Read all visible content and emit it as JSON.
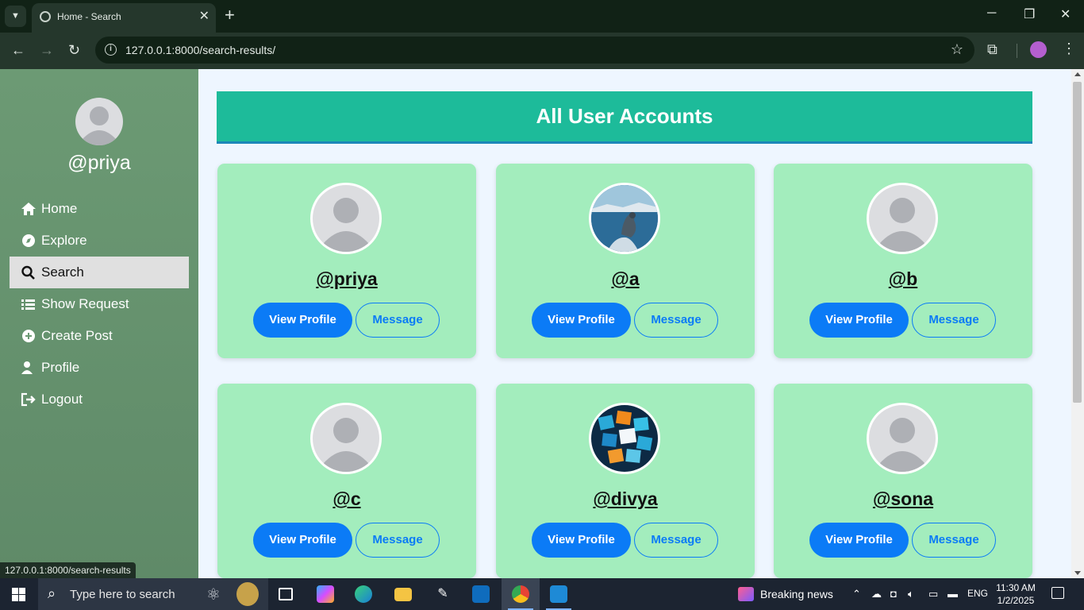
{
  "browser": {
    "tab_title": "Home - Search",
    "tab_close": "✕",
    "new_tab": "+",
    "url": "127.0.0.1:8000/search-results/",
    "status_url": "127.0.0.1:8000/search-results",
    "win_min": "─",
    "win_max": "❐",
    "win_close": "✕"
  },
  "sidebar": {
    "username": "@priya",
    "items": [
      {
        "label": "Home",
        "icon": "home-icon",
        "active": false
      },
      {
        "label": "Explore",
        "icon": "compass-icon",
        "active": false
      },
      {
        "label": "Search",
        "icon": "search-icon",
        "active": true
      },
      {
        "label": "Show Request",
        "icon": "list-icon",
        "active": false
      },
      {
        "label": "Create Post",
        "icon": "plus-circle-icon",
        "active": false
      },
      {
        "label": "Profile",
        "icon": "user-icon",
        "active": false
      },
      {
        "label": "Logout",
        "icon": "logout-icon",
        "active": false
      }
    ]
  },
  "main": {
    "heading": "All User Accounts",
    "view_label": "View Profile",
    "message_label": "Message",
    "users": [
      {
        "username": "@priya",
        "avatar": "default"
      },
      {
        "username": "@a",
        "avatar": "bird-photo"
      },
      {
        "username": "@b",
        "avatar": "default"
      },
      {
        "username": "@c",
        "avatar": "default"
      },
      {
        "username": "@divya",
        "avatar": "social-media-graphic"
      },
      {
        "username": "@sona",
        "avatar": "default"
      }
    ]
  },
  "taskbar": {
    "search_placeholder": "Type here to search",
    "news": "Breaking news",
    "lang": "ENG",
    "time": "11:30 AM",
    "date": "1/2/2025"
  },
  "colors": {
    "banner": "#1dbb9a",
    "card": "#a3edbd",
    "primary": "#0b7bf6",
    "sidebar": "#6c9a74"
  }
}
